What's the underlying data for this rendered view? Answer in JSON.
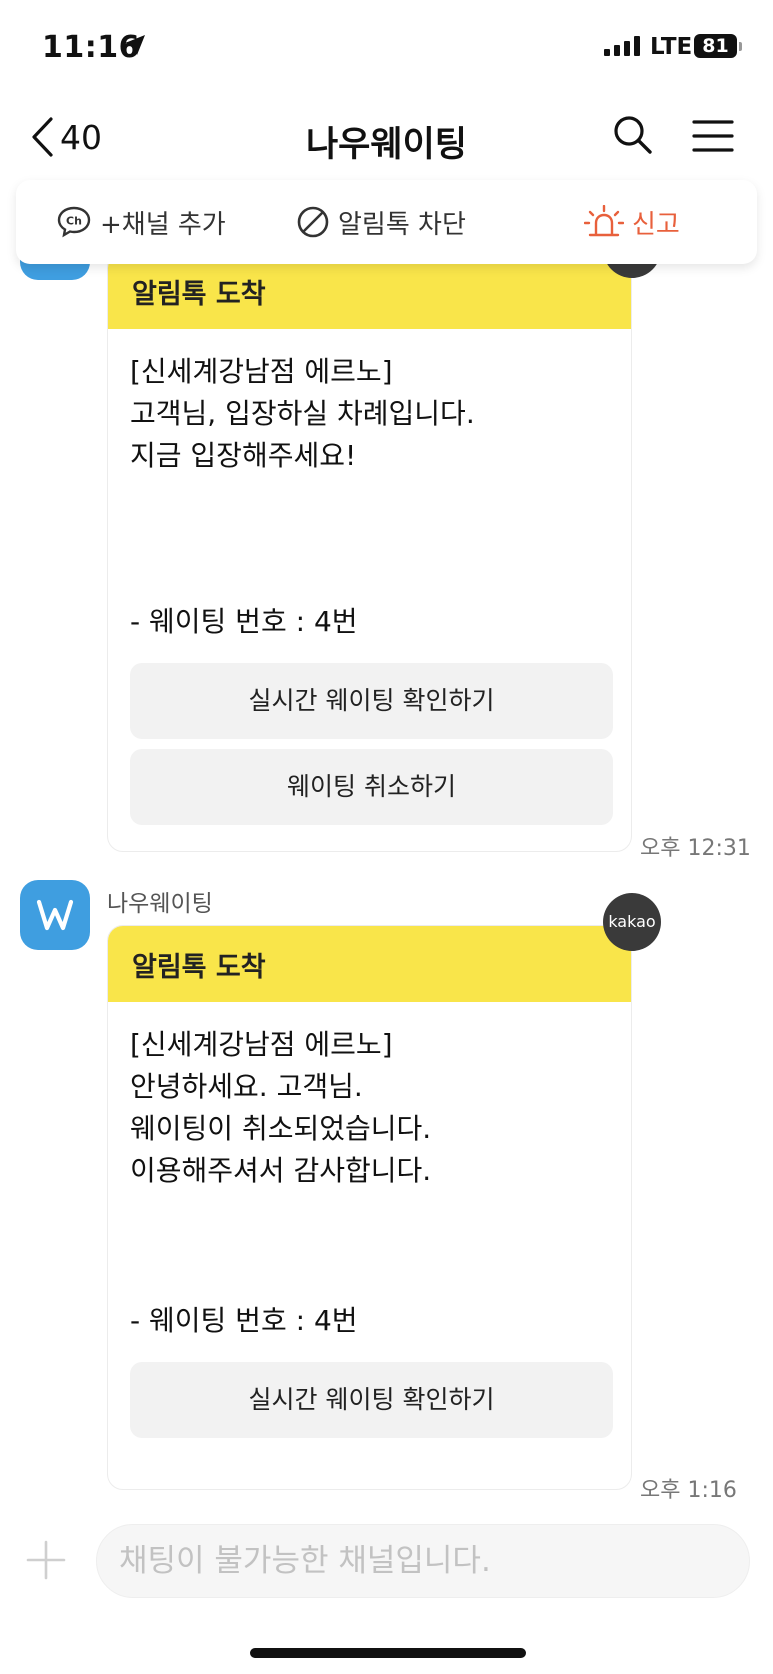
{
  "status_bar": {
    "time": "11:16",
    "network": "LTE",
    "battery": "81"
  },
  "nav": {
    "back_count": "40",
    "title": "나우웨이팅"
  },
  "actions": {
    "add_channel": "+채널 추가",
    "block": "알림톡 차단",
    "report": "신고"
  },
  "messages": [
    {
      "header": "알림톡 도착",
      "lines": [
        "[신세계강남점 에르노]",
        "고객님, 입장하실 차례입니다.",
        "지금 입장해주세요!"
      ],
      "waiting_number": "- 웨이팅 번호 : 4번",
      "buttons": [
        "실시간 웨이팅 확인하기",
        "웨이팅 취소하기"
      ],
      "time": "오후 12:31"
    },
    {
      "sender": "나우웨이팅",
      "badge": "kakao",
      "header": "알림톡 도착",
      "lines": [
        "[신세계강남점 에르노]",
        "안녕하세요. 고객님.",
        "웨이팅이 취소되었습니다.",
        "이용해주셔서 감사합니다."
      ],
      "waiting_number": "- 웨이팅 번호 : 4번",
      "buttons": [
        "실시간 웨이팅 확인하기"
      ],
      "time": "오후 1:16"
    }
  ],
  "input": {
    "placeholder": "채팅이 불가능한 채널입니다."
  },
  "colors": {
    "header_yellow": "#f9e54a",
    "avatar_blue": "#3f9ee0",
    "report_orange": "#e8603c"
  }
}
